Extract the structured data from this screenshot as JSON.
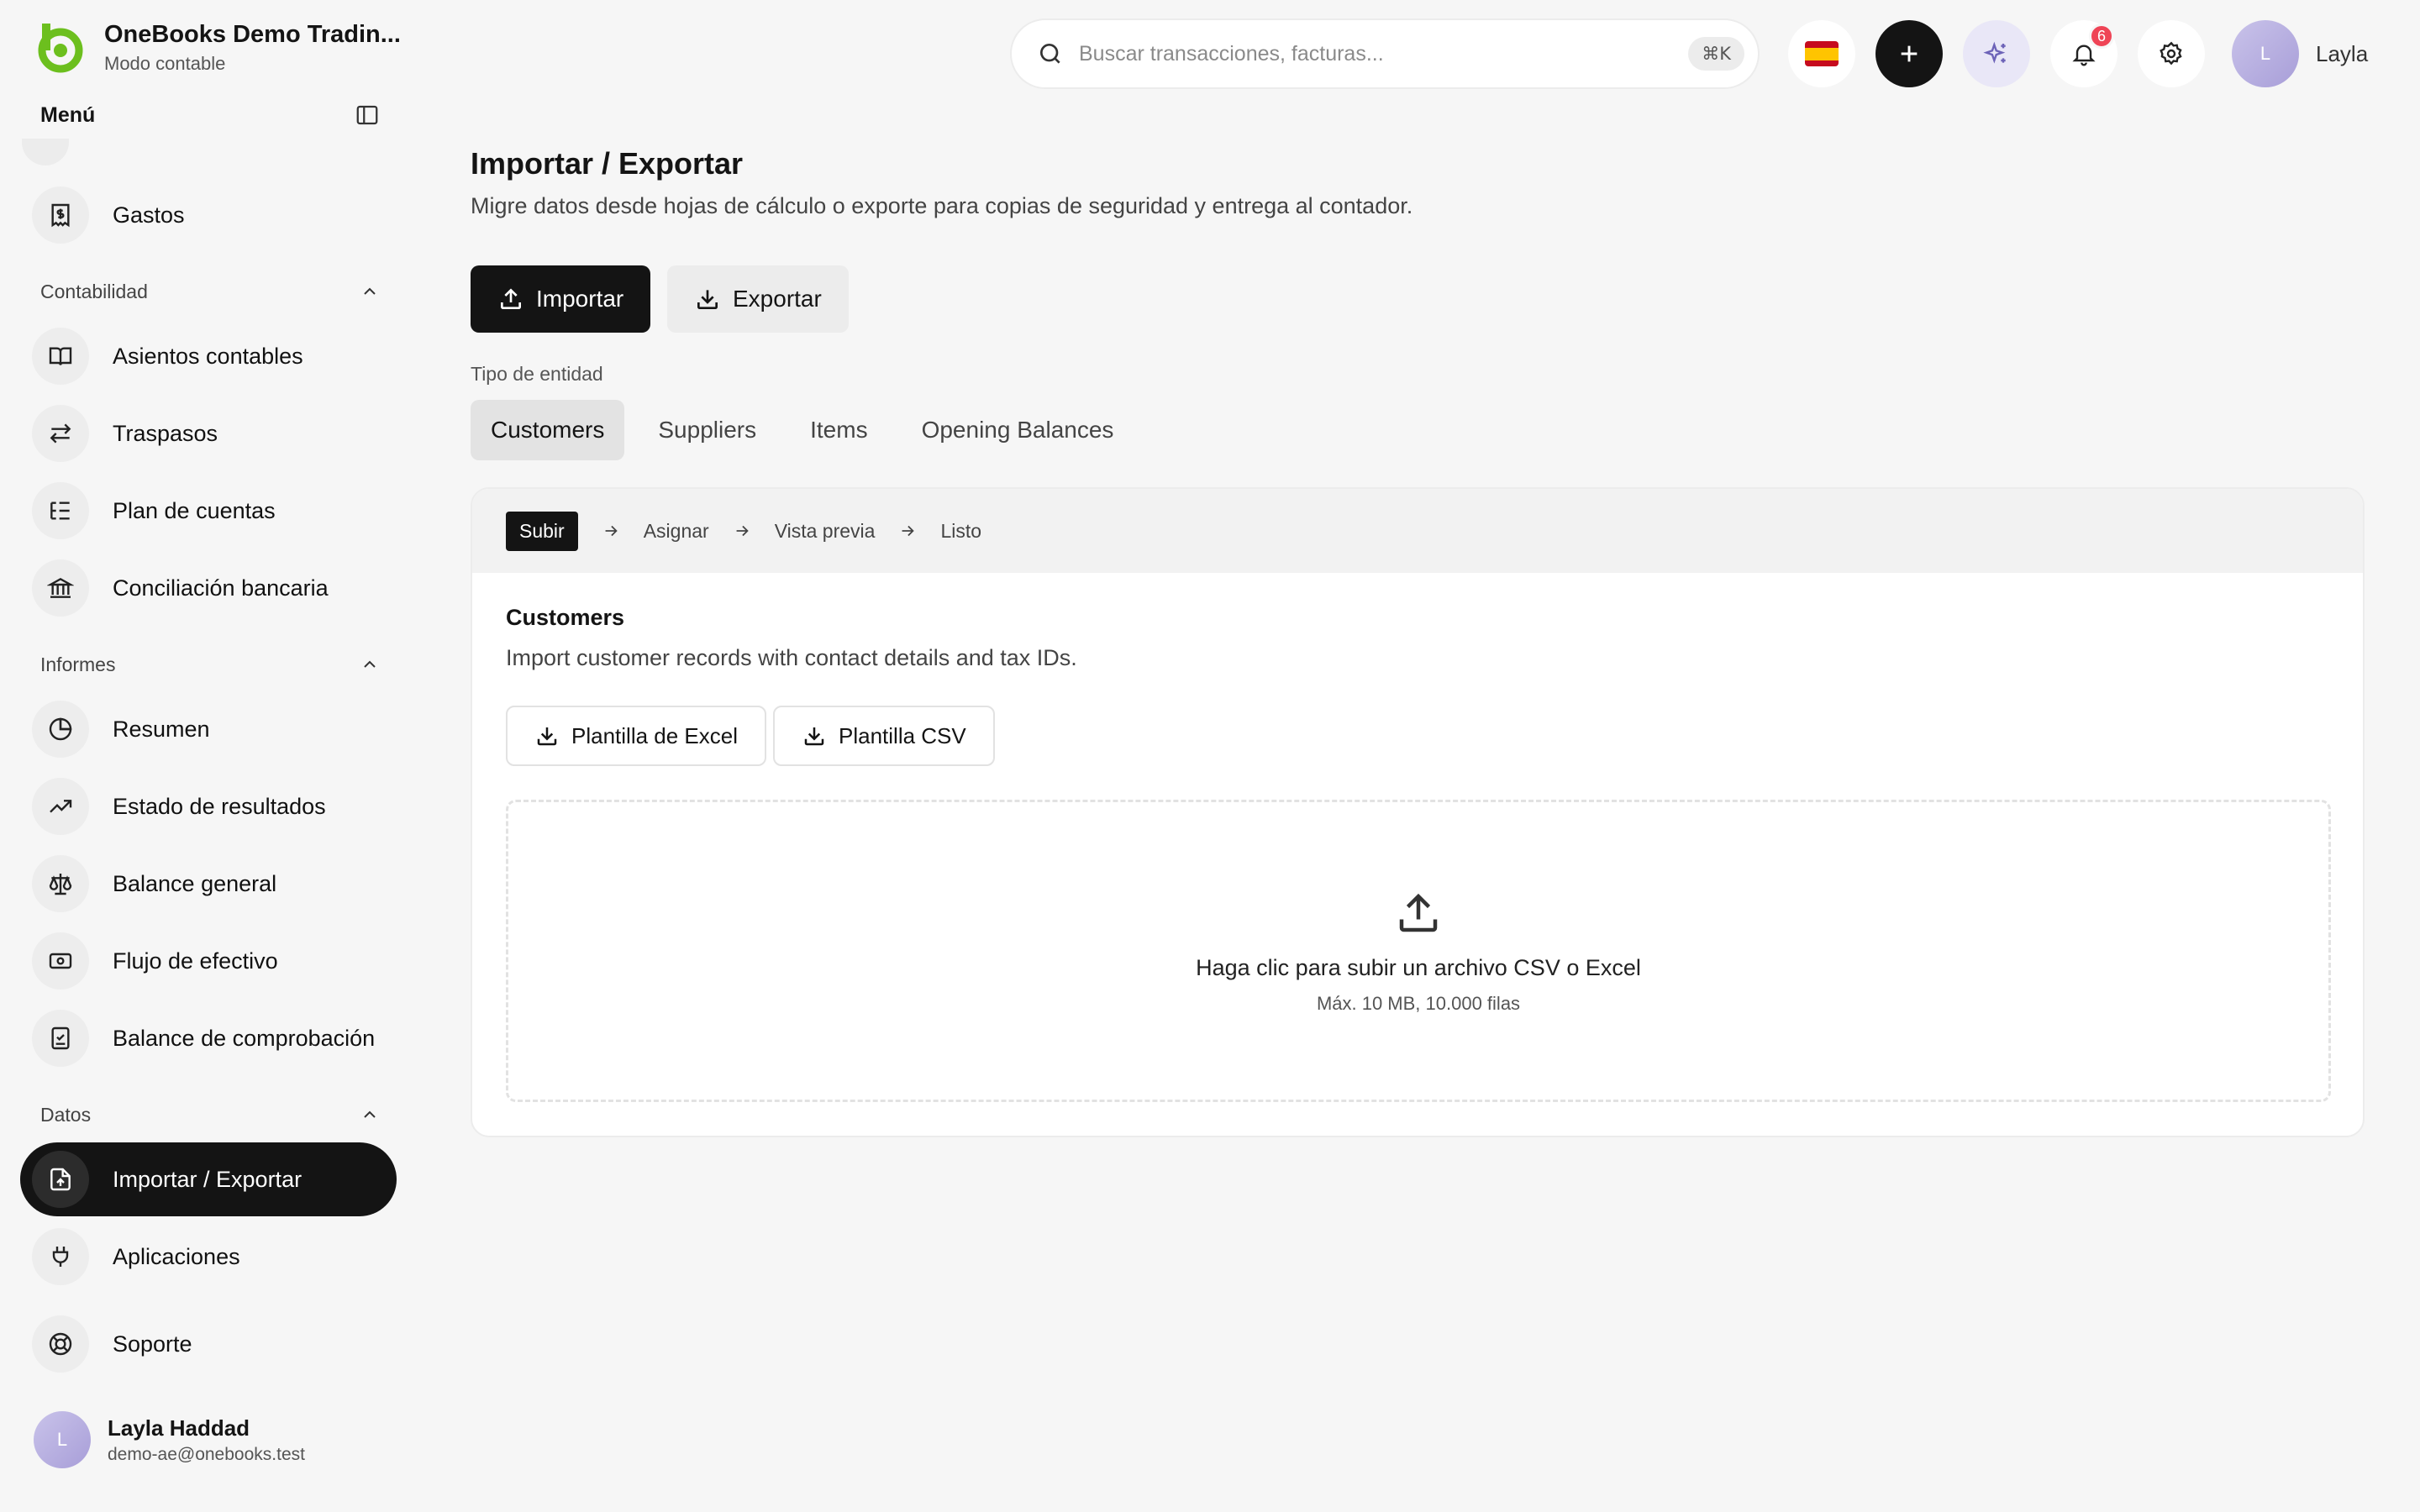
{
  "brand": {
    "name": "OneBooks Demo Tradin...",
    "subtitle": "Modo contable"
  },
  "sidebar": {
    "menu_title": "Menú",
    "item_gastos": "Gastos",
    "sections": {
      "contabilidad": "Contabilidad",
      "informes": "Informes",
      "datos": "Datos"
    },
    "contabilidad_items": [
      "Asientos contables",
      "Traspasos",
      "Plan de cuentas",
      "Conciliación bancaria"
    ],
    "informes_items": [
      "Resumen",
      "Estado de resultados",
      "Balance general",
      "Flujo de efectivo",
      "Balance de comprobación"
    ],
    "datos_items": [
      "Importar / Exportar",
      "Aplicaciones"
    ],
    "support": "Soporte",
    "user": {
      "initial": "L",
      "name": "Layla Haddad",
      "email": "demo-ae@onebooks.test"
    }
  },
  "topbar": {
    "search_placeholder": "Buscar transacciones, facturas...",
    "shortcut": "⌘K",
    "notifications_count": "6",
    "user_initial": "L",
    "user_name": "Layla"
  },
  "main": {
    "title": "Importar / Exportar",
    "subtitle": "Migre datos desde hojas de cálculo o exporte para copias de seguridad y entrega al contador.",
    "import_label": "Importar",
    "export_label": "Exportar",
    "entity_label": "Tipo de entidad",
    "tabs": [
      "Customers",
      "Suppliers",
      "Items",
      "Opening Balances"
    ],
    "steps": [
      "Subir",
      "Asignar",
      "Vista previa",
      "Listo"
    ],
    "card_title": "Customers",
    "card_desc": "Import customer records with contact details and tax IDs.",
    "excel_template": "Plantilla de Excel",
    "csv_template": "Plantilla CSV",
    "drop_main": "Haga clic para subir un archivo CSV o Excel",
    "drop_sub": "Máx. 10 MB, 10.000 filas"
  },
  "colors": {
    "accent_green": "#6cbf1e",
    "active_nav": "#141414",
    "badge": "#ef4456",
    "avatar": "#b3a9df",
    "ai_button": "#e9e7f7"
  }
}
